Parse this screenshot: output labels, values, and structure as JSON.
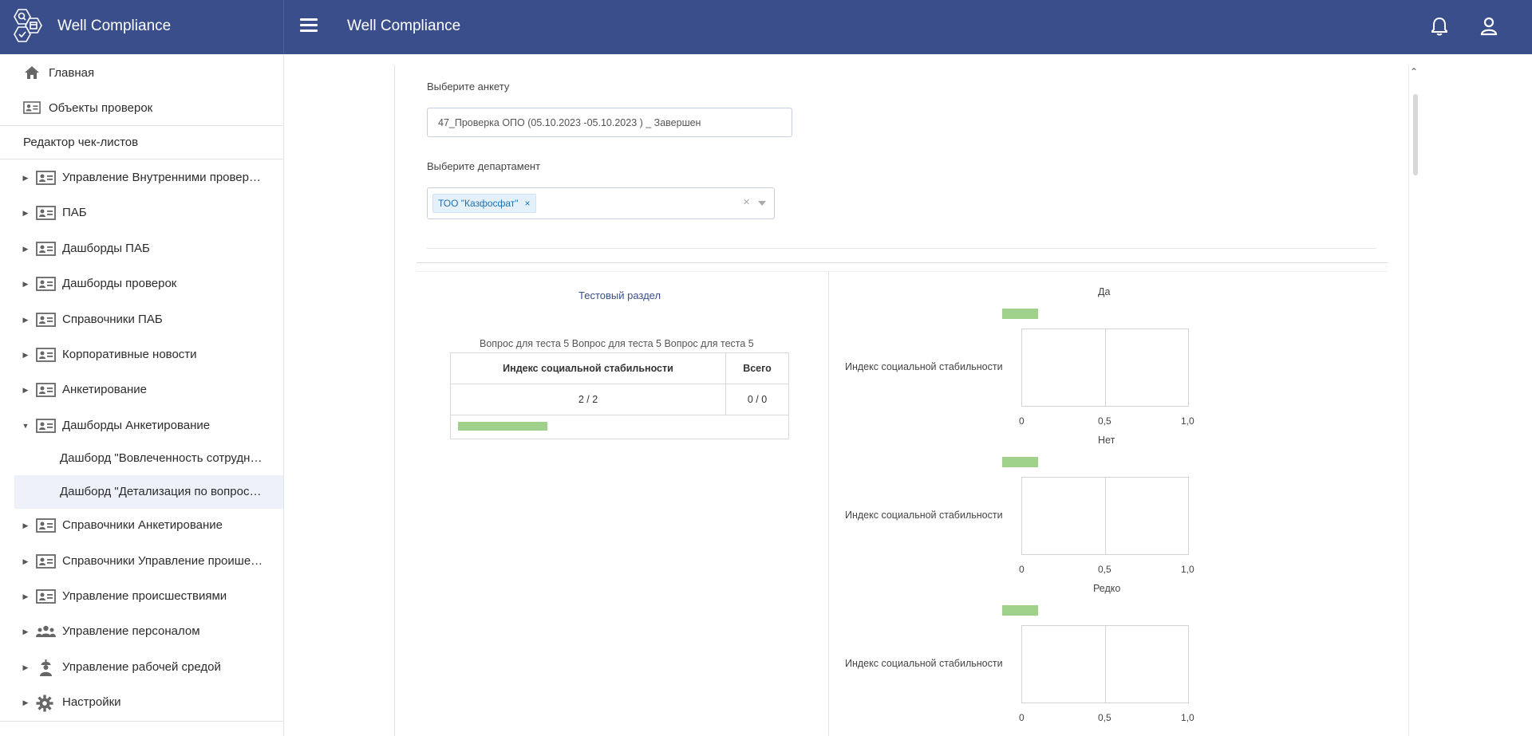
{
  "app": {
    "brand": "Well Compliance",
    "title": "Well Compliance"
  },
  "icons": {
    "menu": "menu-icon",
    "bell": "bell-icon",
    "user": "user-icon"
  },
  "sidebar": {
    "home": "Главная",
    "objects": "Объекты проверок",
    "editor": "Редактор чек-листов",
    "items": [
      {
        "label": "Управление Внутренними провер…",
        "icon": "card-icon",
        "expanded": false
      },
      {
        "label": "ПАБ",
        "icon": "card-icon",
        "expanded": false
      },
      {
        "label": "Дашборды ПАБ",
        "icon": "card-icon",
        "expanded": false
      },
      {
        "label": "Дашборды проверок",
        "icon": "card-icon",
        "expanded": false
      },
      {
        "label": "Справочники ПАБ",
        "icon": "card-icon",
        "expanded": false
      },
      {
        "label": "Корпоративные новости",
        "icon": "card-icon",
        "expanded": false
      },
      {
        "label": "Анкетирование",
        "icon": "card-icon",
        "expanded": false
      },
      {
        "label": "Дашборды Анкетирование",
        "icon": "card-icon",
        "expanded": true
      },
      {
        "label": "Справочники Анкетирование",
        "icon": "card-icon",
        "expanded": false
      },
      {
        "label": "Справочники Управление проише…",
        "icon": "card-icon",
        "expanded": false
      },
      {
        "label": "Управление происшествиями",
        "icon": "card-icon",
        "expanded": false
      },
      {
        "label": "Управление персоналом",
        "icon": "people-icon",
        "expanded": false
      },
      {
        "label": "Управление рабочей средой",
        "icon": "worker-icon",
        "expanded": false
      },
      {
        "label": "Настройки",
        "icon": "gear-icon",
        "expanded": false
      }
    ],
    "subitems": [
      {
        "label": "Дашборд \"Вовлеченность сотрудн…",
        "active": false
      },
      {
        "label": "Дашборд \"Детализация по вопрос…",
        "active": true
      }
    ]
  },
  "filters": {
    "survey_label": "Выберите анкету",
    "survey_value": "47_Проверка ОПО (05.10.2023 -05.10.2023 ) _ Завершен",
    "department_label": "Выберите департамент",
    "department_tag": "ТОО \"Казфосфат\"",
    "tag_remove": "×",
    "clear": "×"
  },
  "section": {
    "title": "Тестовый раздел",
    "question": "Вопрос для теста 5 Вопрос для теста 5 Вопрос для теста 5",
    "table": {
      "headers": [
        "Индекс социальной стабильности",
        "Всего"
      ],
      "row": [
        "2 / 2",
        "0 / 0"
      ]
    },
    "progress": 1.0
  },
  "charts": [
    {
      "title": "Да",
      "ylabel": "Индекс социальной стабильности",
      "ticks": [
        "0",
        "0,5",
        "1,0"
      ]
    },
    {
      "title": "Нет",
      "ylabel": "Индекс социальной стабильности",
      "ticks": [
        "0",
        "0,5",
        "1,0"
      ]
    },
    {
      "title": "Редко",
      "ylabel": "Индекс социальной стабильности",
      "ticks": [
        "0",
        "0,5",
        "1,0"
      ]
    }
  ],
  "chart_data": [
    {
      "type": "bar",
      "title": "Да",
      "categories": [
        "Индекс социальной стабильности"
      ],
      "values": [
        0
      ],
      "xlim": [
        0,
        1.0
      ],
      "grid": true
    },
    {
      "type": "bar",
      "title": "Нет",
      "categories": [
        "Индекс социальной стабильности"
      ],
      "values": [
        0
      ],
      "xlim": [
        0,
        1.0
      ],
      "grid": true
    },
    {
      "type": "bar",
      "title": "Редко",
      "categories": [
        "Индекс социальной стабильности"
      ],
      "values": [
        0
      ],
      "xlim": [
        0,
        1.0
      ],
      "grid": true
    }
  ],
  "colors": {
    "header": "#3a4e8c",
    "bar": "#9fd18a",
    "tag_bg": "#e4f1fb",
    "active_row": "#eef0fa"
  }
}
